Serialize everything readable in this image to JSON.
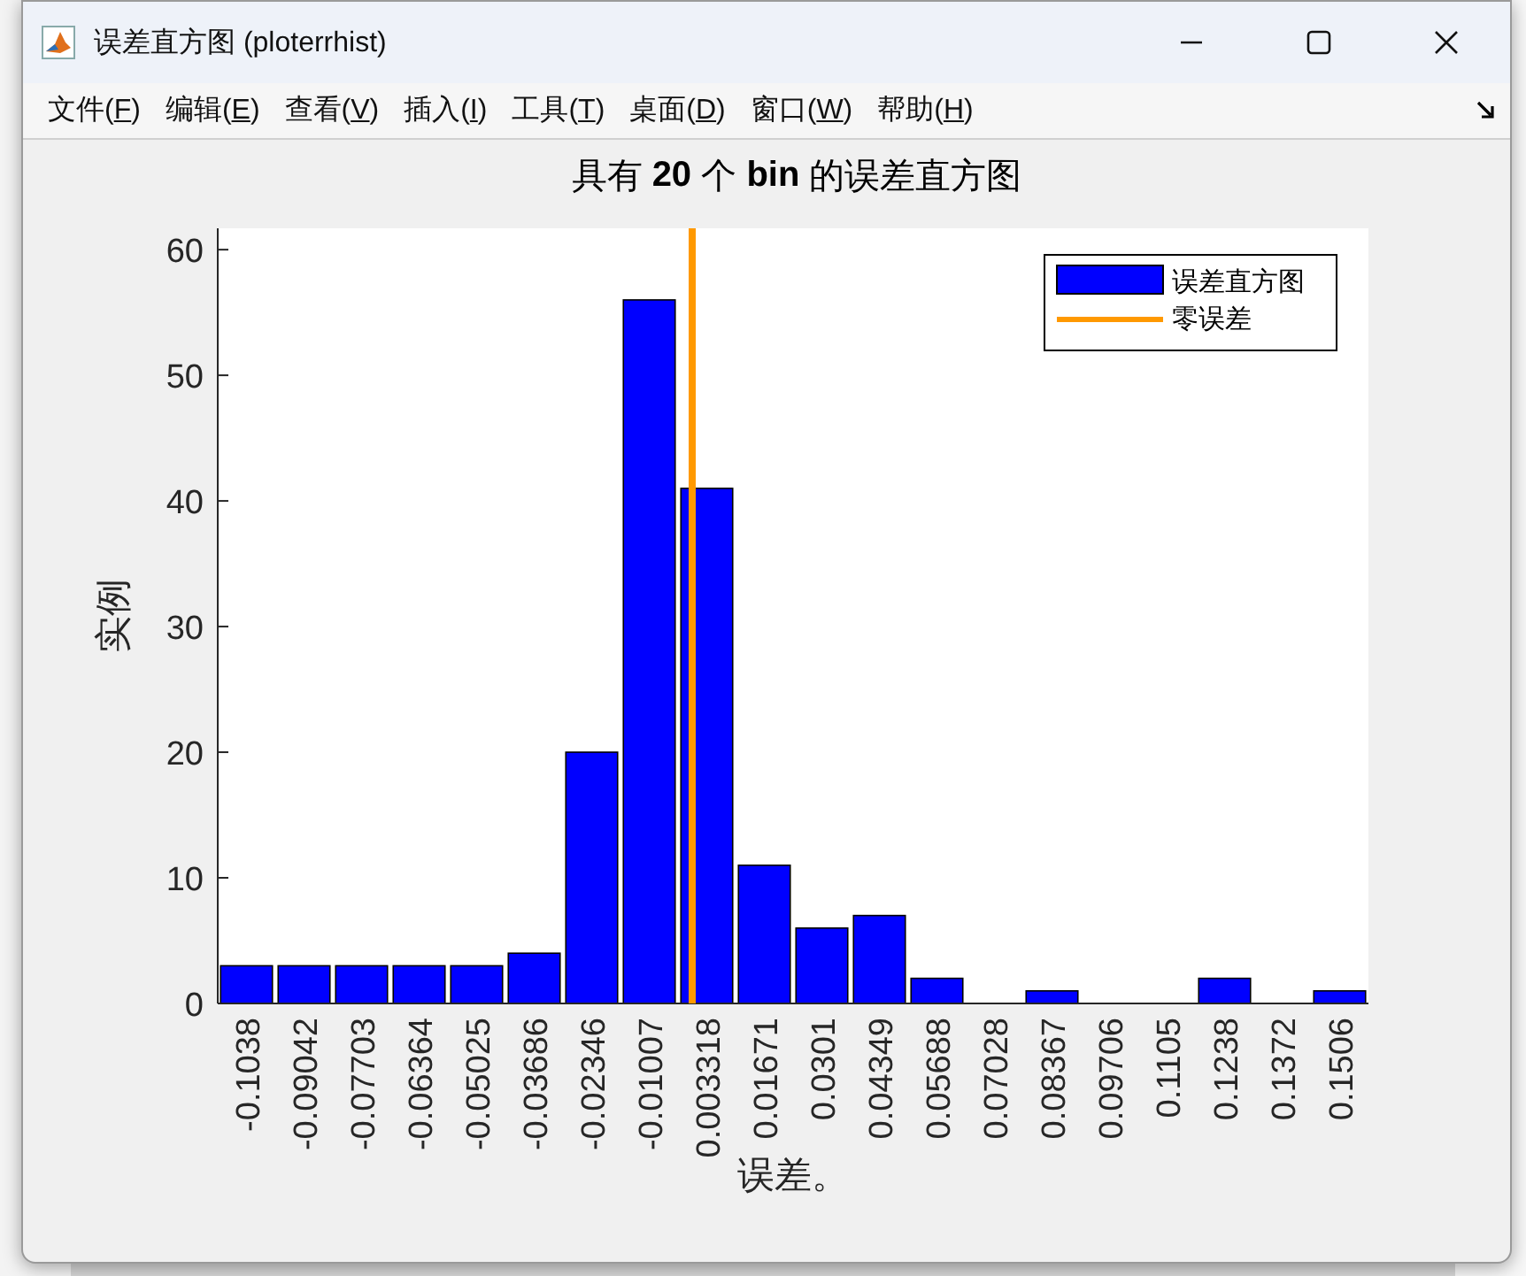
{
  "window": {
    "title": "误差直方图 (ploterrhist)"
  },
  "menu": [
    {
      "before": "文件(",
      "key": "F",
      "after": ")"
    },
    {
      "before": "编辑(",
      "key": "E",
      "after": ")"
    },
    {
      "before": "查看(",
      "key": "V",
      "after": ")"
    },
    {
      "before": "插入(",
      "key": "I",
      "after": ")"
    },
    {
      "before": "工具(",
      "key": "T",
      "after": ")"
    },
    {
      "before": "桌面(",
      "key": "D",
      "after": ")"
    },
    {
      "before": "窗口(",
      "key": "W",
      "after": ")"
    },
    {
      "before": "帮助(",
      "key": "H",
      "after": ")"
    }
  ],
  "figure": {
    "chart_data": {
      "type": "bar",
      "title": "具有 **20** 个 **bin** 的误差直方图",
      "xlabel": "误差。",
      "ylabel": "实例",
      "categories": [
        "-0.1038",
        "-0.09042",
        "-0.07703",
        "-0.06364",
        "-0.05025",
        "-0.03686",
        "-0.02346",
        "-0.01007",
        "0.003318",
        "0.01671",
        "0.0301",
        "0.04349",
        "0.05688",
        "0.07028",
        "0.08367",
        "0.09706",
        "0.1105",
        "0.1238",
        "0.1372",
        "0.1506"
      ],
      "series": [
        {
          "name": "误差直方图",
          "color": "#0000ff",
          "values": [
            3,
            3,
            3,
            3,
            3,
            4,
            20,
            56,
            41,
            11,
            6,
            7,
            2,
            0,
            1,
            0,
            0,
            2,
            0,
            1
          ]
        }
      ],
      "ylim": [
        0,
        61.7
      ],
      "yticks": [
        0,
        10,
        20,
        30,
        40,
        50,
        60
      ]
    },
    "zero_line": {
      "label": "零误差",
      "color": "#ff9900"
    }
  }
}
